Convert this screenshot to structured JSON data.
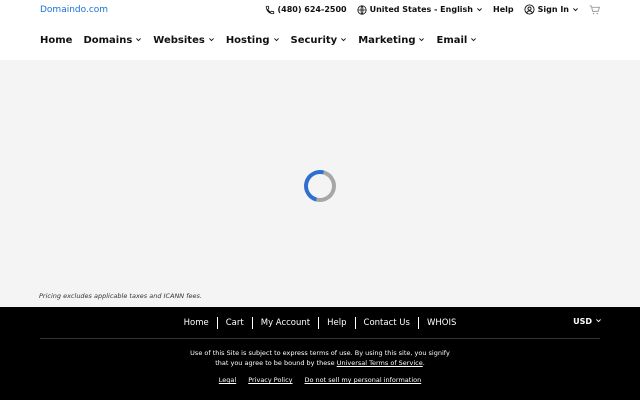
{
  "header": {
    "brand": "Domaindo.com",
    "phone": "(480) 624-2500",
    "locale": "United States - English",
    "help": "Help",
    "sign_in": "Sign In"
  },
  "nav": {
    "items": [
      {
        "label": "Home"
      },
      {
        "label": "Domains"
      },
      {
        "label": "Websites"
      },
      {
        "label": "Hosting"
      },
      {
        "label": "Security"
      },
      {
        "label": "Marketing"
      },
      {
        "label": "Email"
      }
    ]
  },
  "content": {
    "pricing_note": "Pricing excludes applicable taxes and ICANN fees."
  },
  "footer": {
    "links": [
      "Home",
      "Cart",
      "My Account",
      "Help",
      "Contact Us",
      "WHOIS"
    ],
    "currency": "USD",
    "legal_line1": "Use of this Site is subject to express terms of use. By using this site, you signify",
    "legal_line2_prefix": "that you agree to be bound by these",
    "legal_line2_link": "Universal Terms of Service",
    "legal_line2_suffix": ".",
    "legal_links": [
      "Legal",
      "Privacy Policy",
      "Do not sell my personal information"
    ]
  },
  "colors": {
    "brand": "#1a73d9",
    "spinner_accent": "#2f6fd0",
    "footer_bg": "#000000",
    "content_bg": "#f4f4f4"
  },
  "icons": [
    "phone-icon",
    "globe-icon",
    "user-icon",
    "cart-icon",
    "chevron-down-icon"
  ]
}
